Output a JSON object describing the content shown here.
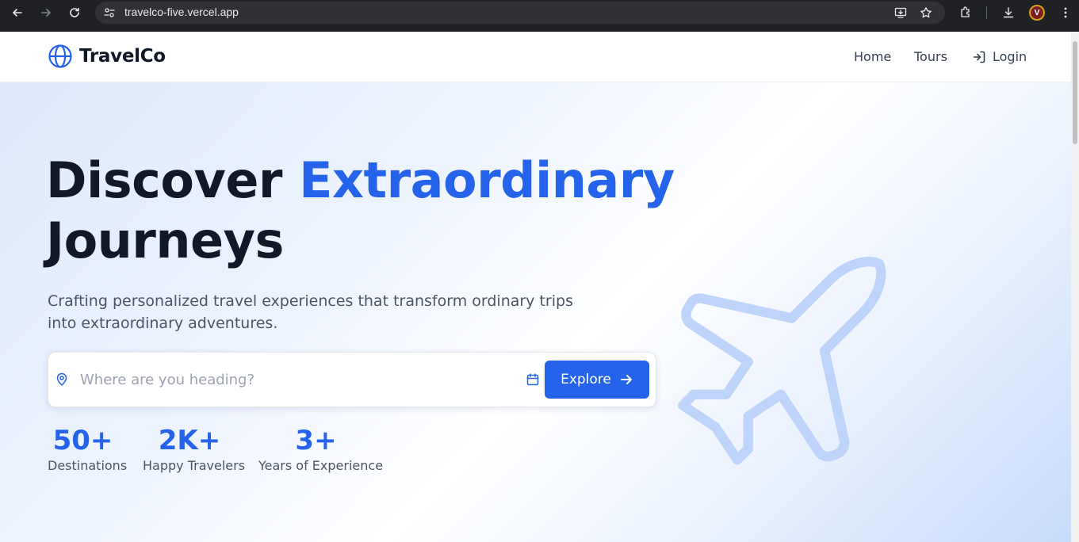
{
  "browser": {
    "url": "travelco-five.vercel.app",
    "profile_initial": "V"
  },
  "header": {
    "brand": "TravelCo",
    "nav": {
      "home": "Home",
      "tours": "Tours",
      "login": "Login"
    }
  },
  "hero": {
    "headline_part1": "Discover ",
    "headline_accent": "Extraordinary",
    "headline_part2": "Journeys",
    "subtitle": "Crafting personalized travel experiences that transform ordinary trips into extraordinary adventures.",
    "search": {
      "placeholder": "Where are you heading?",
      "value": "",
      "button_label": "Explore"
    },
    "stats": [
      {
        "value": "50+",
        "label": "Destinations"
      },
      {
        "value": "2K+",
        "label": "Happy Travelers"
      },
      {
        "value": "3+",
        "label": "Years of Experience"
      }
    ]
  },
  "colors": {
    "accent": "#2563eb",
    "text_dark": "#111827",
    "text_muted": "#4b5563"
  },
  "icons": {
    "logo": "globe-icon",
    "login": "log-in-icon",
    "search": "map-pin-icon",
    "date": "calendar-icon",
    "explore": "arrow-right-icon",
    "decoration": "airplane-icon"
  }
}
